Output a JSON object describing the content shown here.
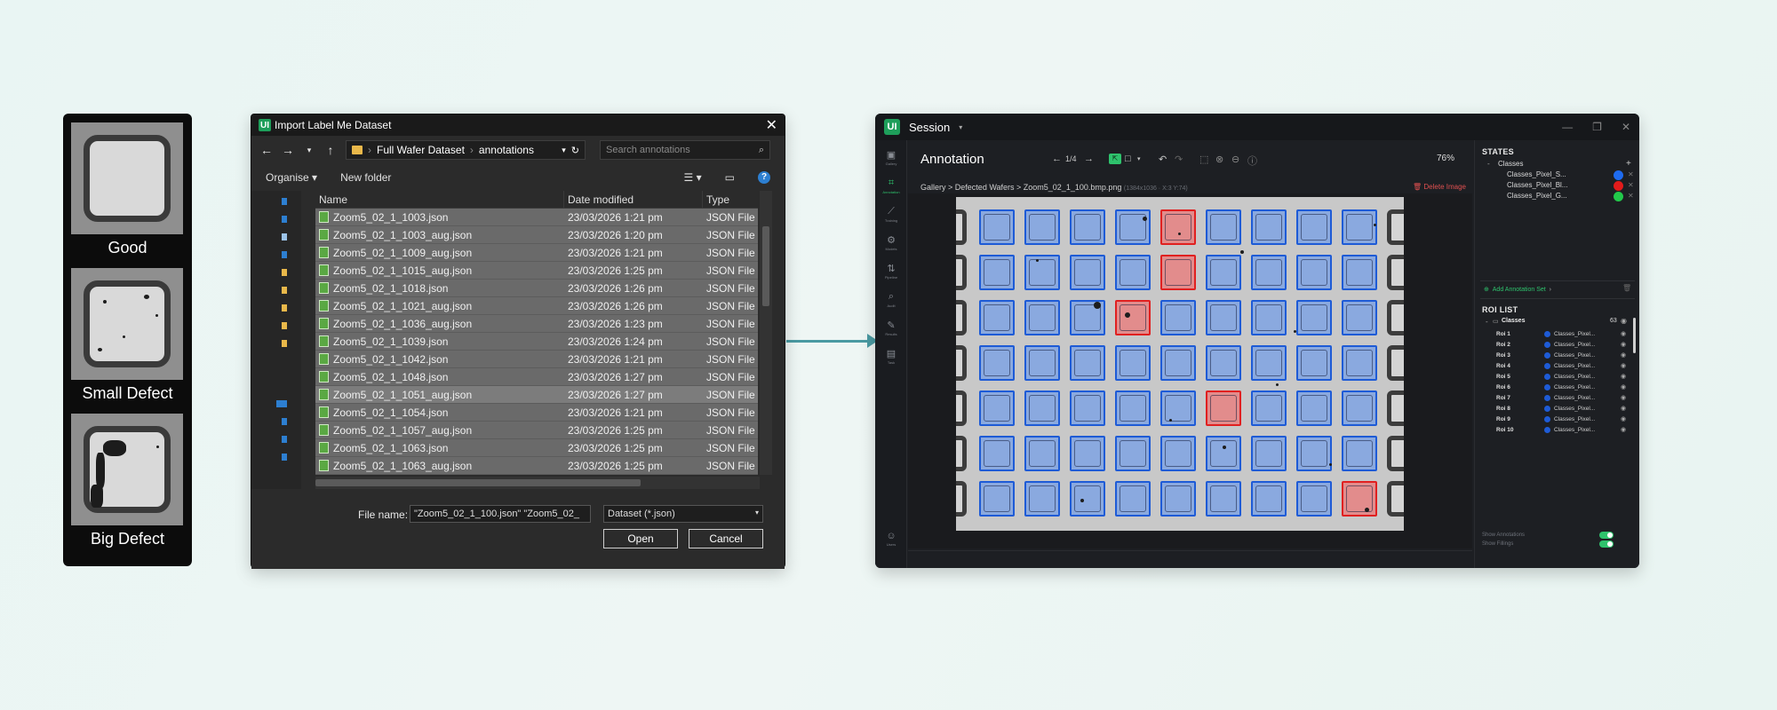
{
  "samples": [
    {
      "label": "Good"
    },
    {
      "label": "Small Defect"
    },
    {
      "label": "Big Defect"
    }
  ],
  "dialog": {
    "title": "Import Label Me Dataset",
    "logo_text": "UI",
    "path": [
      "Full Wafer Dataset",
      "annotations"
    ],
    "search_placeholder": "Search annotations",
    "toolbar": {
      "organise": "Organise",
      "new_folder": "New folder"
    },
    "columns": [
      "Name",
      "Date modified",
      "Type"
    ],
    "files": [
      {
        "name": "Zoom5_02_1_1003.json",
        "date": "23/03/2026 1:21 pm",
        "type": "JSON File"
      },
      {
        "name": "Zoom5_02_1_1003_aug.json",
        "date": "23/03/2026 1:20 pm",
        "type": "JSON File"
      },
      {
        "name": "Zoom5_02_1_1009_aug.json",
        "date": "23/03/2026 1:21 pm",
        "type": "JSON File"
      },
      {
        "name": "Zoom5_02_1_1015_aug.json",
        "date": "23/03/2026 1:25 pm",
        "type": "JSON File"
      },
      {
        "name": "Zoom5_02_1_1018.json",
        "date": "23/03/2026 1:26 pm",
        "type": "JSON File"
      },
      {
        "name": "Zoom5_02_1_1021_aug.json",
        "date": "23/03/2026 1:26 pm",
        "type": "JSON File"
      },
      {
        "name": "Zoom5_02_1_1036_aug.json",
        "date": "23/03/2026 1:23 pm",
        "type": "JSON File"
      },
      {
        "name": "Zoom5_02_1_1039.json",
        "date": "23/03/2026 1:24 pm",
        "type": "JSON File"
      },
      {
        "name": "Zoom5_02_1_1042.json",
        "date": "23/03/2026 1:21 pm",
        "type": "JSON File"
      },
      {
        "name": "Zoom5_02_1_1048.json",
        "date": "23/03/2026 1:27 pm",
        "type": "JSON File"
      },
      {
        "name": "Zoom5_02_1_1051_aug.json",
        "date": "23/03/2026 1:27 pm",
        "type": "JSON File"
      },
      {
        "name": "Zoom5_02_1_1054.json",
        "date": "23/03/2026 1:21 pm",
        "type": "JSON File"
      },
      {
        "name": "Zoom5_02_1_1057_aug.json",
        "date": "23/03/2026 1:25 pm",
        "type": "JSON File"
      },
      {
        "name": "Zoom5_02_1_1063.json",
        "date": "23/03/2026 1:25 pm",
        "type": "JSON File"
      },
      {
        "name": "Zoom5_02_1_1063_aug.json",
        "date": "23/03/2026 1:25 pm",
        "type": "JSON File"
      }
    ],
    "filename_label": "File name:",
    "filename_value": "\"Zoom5_02_1_100.json\" \"Zoom5_02_",
    "filetype": "Dataset (*.json)",
    "open_label": "Open",
    "cancel_label": "Cancel"
  },
  "app": {
    "logo_text": "UI",
    "session_label": "Session",
    "rail": [
      "Gallery",
      "Annotation",
      "Training",
      "Models",
      "Pipeline",
      "Audit",
      "Results",
      "Task",
      "Users"
    ],
    "title": "Annotation",
    "pager": "1/4",
    "zoom": "76%",
    "breadcrumb": [
      "Gallery",
      "Defected Wafers",
      "Zoom5_02_1_100.bmp.png"
    ],
    "image_meta": "(1384x1036 · X:3 Y:74)",
    "delete_label": "Delete Image",
    "states": {
      "header": "STATES",
      "group": "Classes",
      "items": [
        {
          "name": "Classes_Pixel_S...",
          "color": "#1e6bf0"
        },
        {
          "name": "Classes_Pixel_Bl...",
          "color": "#e21b1b"
        },
        {
          "name": "Classes_Pixel_G...",
          "color": "#22c84a"
        }
      ],
      "add_set": "Add Annotation Set"
    },
    "roi": {
      "header": "ROI LIST",
      "group": "Classes",
      "count": "63",
      "items": [
        {
          "name": "Roi 1",
          "cls": "Classes_Pixel..."
        },
        {
          "name": "Roi 2",
          "cls": "Classes_Pixel..."
        },
        {
          "name": "Roi 3",
          "cls": "Classes_Pixel..."
        },
        {
          "name": "Roi 4",
          "cls": "Classes_Pixel..."
        },
        {
          "name": "Roi 5",
          "cls": "Classes_Pixel..."
        },
        {
          "name": "Roi 6",
          "cls": "Classes_Pixel..."
        },
        {
          "name": "Roi 7",
          "cls": "Classes_Pixel..."
        },
        {
          "name": "Roi 8",
          "cls": "Classes_Pixel..."
        },
        {
          "name": "Roi 9",
          "cls": "Classes_Pixel..."
        },
        {
          "name": "Roi 10",
          "cls": "Classes_Pixel..."
        }
      ],
      "show_annotations": "Show Annotations",
      "show_fillings": "Show Fillings"
    },
    "grid": {
      "rows": 7,
      "cols": 9,
      "defects": [
        [
          0,
          4
        ],
        [
          1,
          4
        ],
        [
          2,
          3
        ],
        [
          4,
          5
        ],
        [
          6,
          8
        ]
      ]
    }
  }
}
